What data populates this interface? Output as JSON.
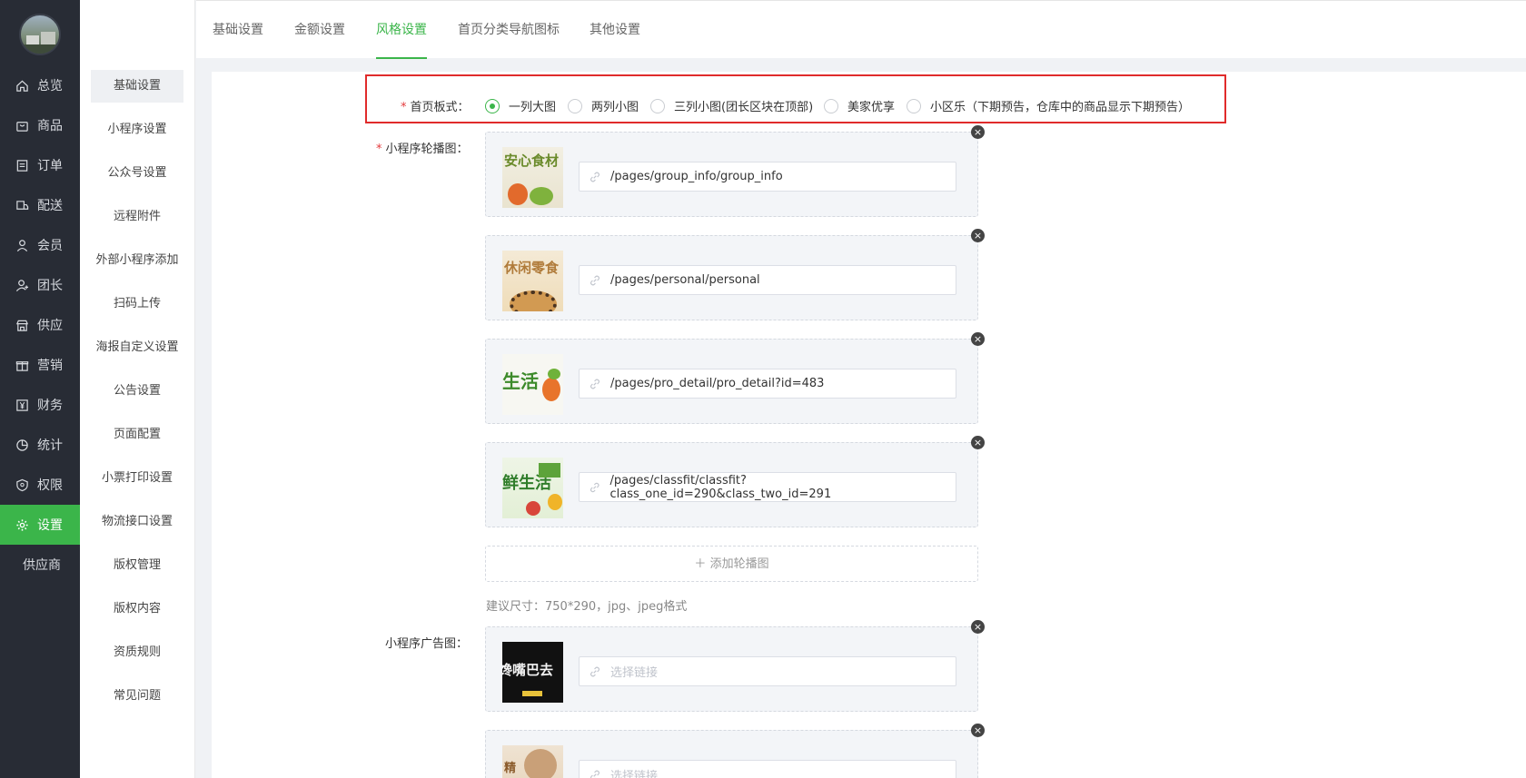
{
  "sidebar": {
    "items": [
      {
        "label": "总览",
        "icon": "home-icon"
      },
      {
        "label": "商品",
        "icon": "bag-icon"
      },
      {
        "label": "订单",
        "icon": "order-icon"
      },
      {
        "label": "配送",
        "icon": "delivery-icon"
      },
      {
        "label": "会员",
        "icon": "user-icon"
      },
      {
        "label": "团长",
        "icon": "leader-icon"
      },
      {
        "label": "供应",
        "icon": "store-icon"
      },
      {
        "label": "营销",
        "icon": "gift-icon"
      },
      {
        "label": "财务",
        "icon": "yen-icon"
      },
      {
        "label": "统计",
        "icon": "pie-chart-icon"
      },
      {
        "label": "权限",
        "icon": "shield-icon"
      },
      {
        "label": "设置",
        "icon": "gear-icon"
      }
    ],
    "active": "设置",
    "extra": "供应商"
  },
  "submenu": {
    "items": [
      "基础设置",
      "小程序设置",
      "公众号设置",
      "远程附件",
      "外部小程序添加",
      "扫码上传",
      "海报自定义设置",
      "公告设置",
      "页面配置",
      "小票打印设置",
      "物流接口设置",
      "版权管理",
      "版权内容",
      "资质规则",
      "常见问题"
    ],
    "active": "基础设置"
  },
  "tabs": {
    "items": [
      "基础设置",
      "金额设置",
      "风格设置",
      "首页分类导航图标",
      "其他设置"
    ],
    "active": "风格设置"
  },
  "form": {
    "layout_label": "首页板式：",
    "layout_options": [
      "一列大图",
      "两列小图",
      "三列小图(团长区块在顶部)",
      "美家优享",
      "小区乐（下期预告，仓库中的商品显示下期预告）"
    ],
    "layout_selected": "一列大图",
    "carousel_label": "小程序轮播图：",
    "carousel": [
      {
        "thumb_text": "安心食材",
        "link": "/pages/group_info/group_info"
      },
      {
        "thumb_text": "休闲零食",
        "link": "/pages/personal/personal"
      },
      {
        "thumb_text": "生活",
        "link": "/pages/pro_detail/pro_detail?id=483"
      },
      {
        "thumb_text": "鲜生活",
        "link": "/pages/classfit/classfit?class_one_id=290&class_two_id=291"
      }
    ],
    "add_carousel": "添加轮播图",
    "size_hint": "建议尺寸：750*290，jpg、jpeg格式",
    "ad_label": "小程序广告图：",
    "ads": [
      {
        "thumb_text": "馋嘴巴去",
        "placeholder": "选择链接"
      },
      {
        "thumb_text": "精",
        "placeholder": "选择链接"
      }
    ]
  },
  "colors": {
    "accent": "#3bb54a",
    "sidebar_bg": "#282c35",
    "highlight_border": "#e02b2b"
  }
}
